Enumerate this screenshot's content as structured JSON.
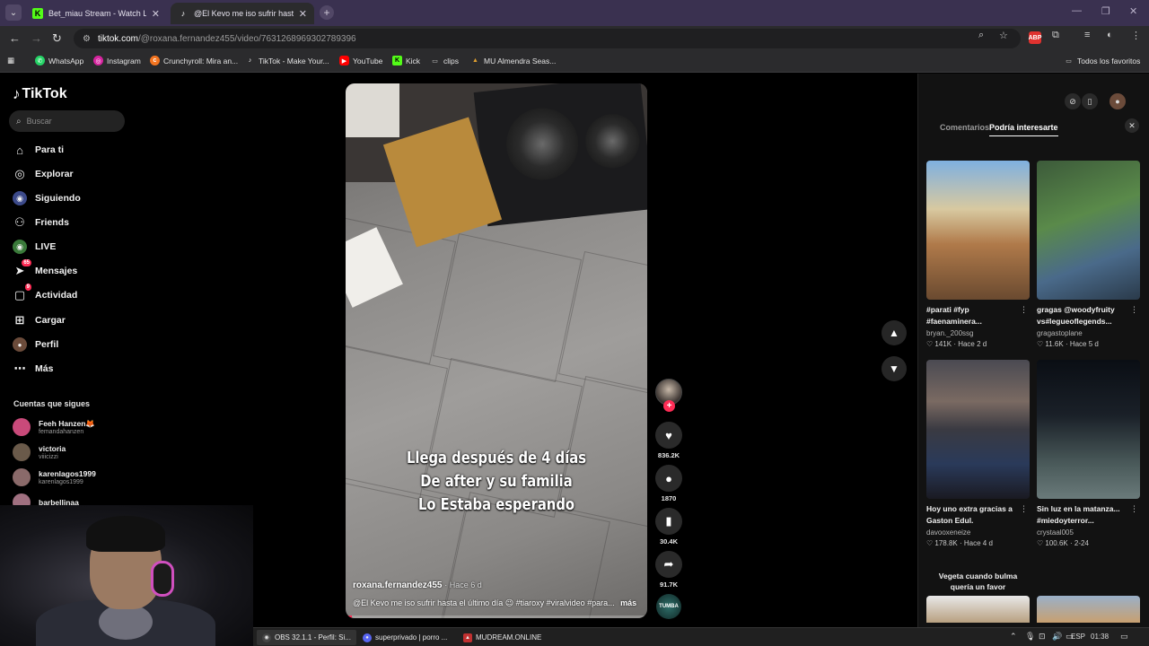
{
  "browser": {
    "tabs": [
      {
        "title": "Bet_miau Stream - Watch Live o",
        "active": false,
        "favicon": "kick-icon"
      },
      {
        "title": "@El Kevo me iso sufrir hasta el",
        "active": true,
        "favicon": "tiktok-icon"
      }
    ],
    "url_domain": "tiktok.com",
    "url_path": "/@roxana.fernandez455/video/7631268969302789396",
    "bookmarks": [
      "WhatsApp",
      "Instagram",
      "Crunchyroll: Mira an...",
      "TikTok - Make Your...",
      "YouTube",
      "Kick",
      "clips",
      "MU Almendra Seas..."
    ],
    "all_bookmarks": "Todos los favoritos",
    "extension_label": "ABP"
  },
  "tiktok": {
    "logo": "TikTok",
    "search_placeholder": "Buscar",
    "nav": [
      {
        "label": "Para ti",
        "icon": "home-icon"
      },
      {
        "label": "Explorar",
        "icon": "compass-icon"
      },
      {
        "label": "Siguiendo",
        "icon": "following-icon"
      },
      {
        "label": "Friends",
        "icon": "friends-icon"
      },
      {
        "label": "LIVE",
        "icon": "live-icon"
      },
      {
        "label": "Mensajes",
        "icon": "messages-icon",
        "badge": "65"
      },
      {
        "label": "Actividad",
        "icon": "activity-icon",
        "badge": "9"
      },
      {
        "label": "Cargar",
        "icon": "upload-icon"
      },
      {
        "label": "Perfil",
        "icon": "profile-icon"
      },
      {
        "label": "Más",
        "icon": "more-icon"
      }
    ],
    "following_title": "Cuentas que sigues",
    "following": [
      {
        "name": "Feeh Hanzen🦊",
        "handle": "femandahanzen"
      },
      {
        "name": "victoria",
        "handle": "viiicizzi"
      },
      {
        "name": "karenlagos1999",
        "handle": "karenlagos1999"
      },
      {
        "name": "barbellinaa",
        "handle": ""
      }
    ]
  },
  "video": {
    "caption_lines": [
      "Llega después de 4 días",
      "De after y su familia",
      "Lo Estaba esperando"
    ],
    "author": "roxana.fernandez455",
    "ago": "Hace 6 d",
    "description": "@El Kevo me iso sufrir hasta el último día 😉 #tiaroxy #viralvideo #para...",
    "more": "más",
    "progress": 0.02,
    "music_label": "TUMBA",
    "actions": [
      {
        "icon": "heart-icon",
        "glyph": "♥",
        "count": "836.2K"
      },
      {
        "icon": "comment-icon",
        "glyph": "●",
        "count": "1870"
      },
      {
        "icon": "bookmark-icon",
        "glyph": "▮",
        "count": "30.4K"
      },
      {
        "icon": "share-icon",
        "glyph": "➦",
        "count": "91.7K"
      }
    ]
  },
  "right_panel": {
    "tab_comments": "Comentarios",
    "tab_interest": "Podría interesarte",
    "cards": [
      {
        "title_1": "#parati #fyp",
        "title_2": "#faenaminera...",
        "user": "bryan._200ssg",
        "likes": "141K",
        "ago": "Hace 2 d"
      },
      {
        "title_1": "gragas @woodyfruity",
        "title_2": "vs#legueoflegends...",
        "user": "gragastoplane",
        "likes": "11.6K",
        "ago": "Hace 5 d"
      },
      {
        "title_1": "Hoy uno extra gracias a",
        "title_2": "Gaston Edul.",
        "user": "davooxeneize",
        "likes": "178.8K",
        "ago": "Hace 4 d"
      },
      {
        "title_1": "Sin luz en la matanza...",
        "title_2": "#miedoyterror...",
        "user": "crystaal005",
        "likes": "100.6K",
        "ago": "2-24"
      }
    ],
    "next_title_1": "Vegeta cuando bulma",
    "next_title_2": "quería un favor"
  },
  "taskbar": {
    "apps": [
      "OBS 32.1.1 - Perfil: Si...",
      "superprivado | porro ...",
      "MUDREAM.ONLINE"
    ],
    "lang": "ESP",
    "time": "01:38"
  }
}
